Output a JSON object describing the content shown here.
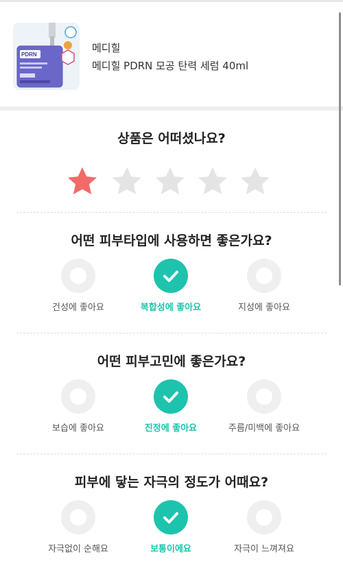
{
  "product": {
    "brand": "메디힐",
    "name": "메디힐 PDRN 모공 탄력 세럼 40ml",
    "image_label": "PDRN"
  },
  "rating": {
    "question": "상품은 어떠셨나요?",
    "value": 1,
    "max": 5,
    "active_color": "#f26b6b",
    "inactive_color": "#e4e4e4"
  },
  "questions": [
    {
      "title": "어떤 피부타입에 사용하면 좋은가요?",
      "options": [
        {
          "label": "건성에 좋아요",
          "selected": false
        },
        {
          "label": "복합성에 좋아요",
          "selected": true
        },
        {
          "label": "지성에 좋아요",
          "selected": false
        }
      ]
    },
    {
      "title": "어떤 피부고민에 좋은가요?",
      "options": [
        {
          "label": "보습에 좋아요",
          "selected": false
        },
        {
          "label": "진정에 좋아요",
          "selected": true
        },
        {
          "label": "주름/미백에 좋아요",
          "selected": false
        }
      ]
    },
    {
      "title": "피부에 닿는 자극의 정도가 어때요?",
      "options": [
        {
          "label": "자극없이 순해요",
          "selected": false
        },
        {
          "label": "보통이에요",
          "selected": true
        },
        {
          "label": "자극이 느껴져요",
          "selected": false
        }
      ]
    }
  ],
  "colors": {
    "accent": "#1dc3ad",
    "section_divider": "#eeeeee"
  }
}
